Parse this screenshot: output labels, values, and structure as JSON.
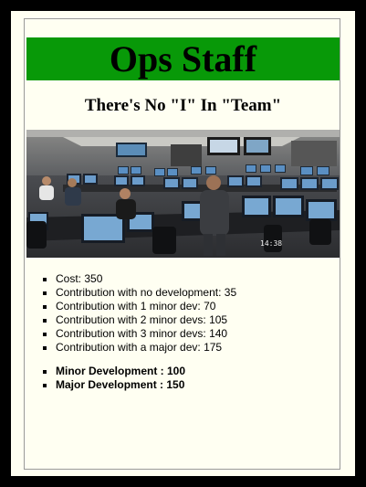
{
  "card": {
    "title": "Ops Staff",
    "subtitle": "There's No \"I\" In \"Team\"",
    "accent_color": "#089908",
    "image": {
      "subject": "operations control room with staff at rows of monitor workstations",
      "timestamp_overlay": "14:38"
    },
    "stats": [
      "Cost: 350",
      "Contribution with no development: 35",
      "Contribution with 1 minor dev: 70",
      "Contribution with 2 minor devs: 105",
      "Contribution with 3 minor devs: 140",
      "Contribution with a major dev: 175"
    ],
    "developments": [
      "Minor Development : 100",
      "Major Development : 150"
    ]
  }
}
